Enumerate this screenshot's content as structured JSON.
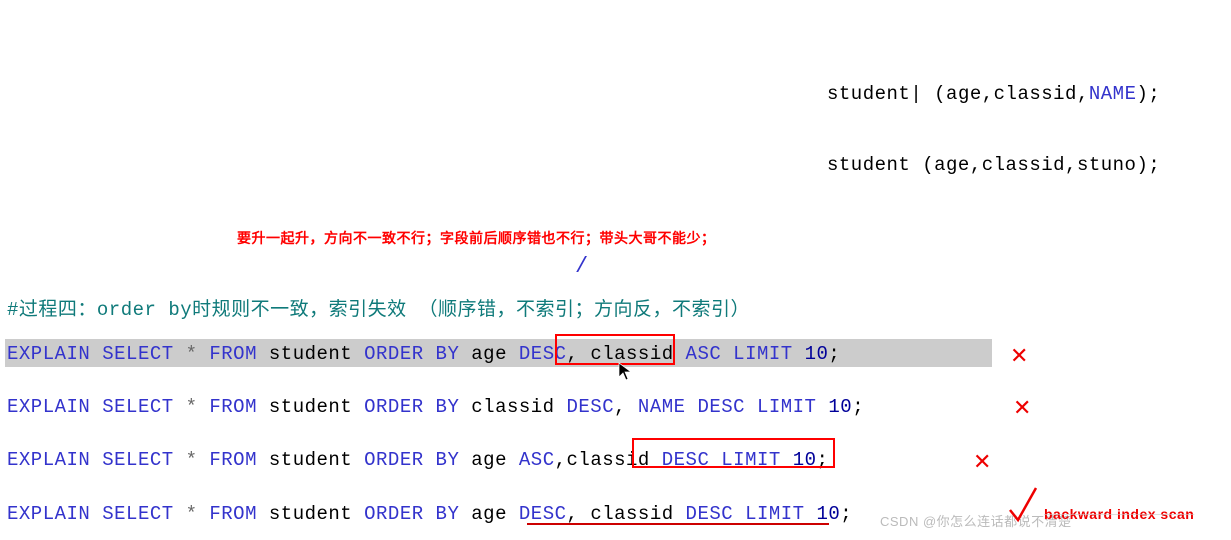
{
  "top1": {
    "student": "student",
    "cursor": "|",
    "open": " (age,classid,",
    "name_kw": "NAME",
    "close": ");"
  },
  "top2": {
    "text": "student (age,classid,stuno);"
  },
  "red_note": "要升一起升，方向不一致不行；字段前后顺序错也不行；带头大哥不能少；",
  "comment": "#过程四：order by时规则不一致，索引失效 （顺序错，不索引；方向反，不索引）",
  "dangling": "/",
  "sql1": {
    "explain": "EXPLAIN",
    "sp1": "  ",
    "select": "SELECT",
    "sp2": " ",
    "star": "*",
    "sp3": " ",
    "from": "FROM",
    "sp4": " ",
    "table": "student",
    "sp5": " ",
    "order": "ORDER",
    "sp6": " ",
    "by": "BY",
    "sp7": " ",
    "col1": "age",
    "sp8": " ",
    "dir1": "DESC",
    "com1": ",",
    "sp9": " ",
    "col2": "classid",
    "sp10": " ",
    "dir2": "ASC",
    "sp11": " ",
    "limit": "LIMIT",
    "sp12": " ",
    "num": "10",
    "semi": ";"
  },
  "sql2": {
    "explain": "EXPLAIN",
    "sp1": "  ",
    "select": "SELECT",
    "sp2": " ",
    "star": "*",
    "sp3": " ",
    "from": "FROM",
    "sp4": " ",
    "table": "student",
    "sp5": " ",
    "order": "ORDER",
    "sp6": " ",
    "by": "BY",
    "sp7": " ",
    "col1": "classid",
    "sp8": " ",
    "dir1": "DESC",
    "com1": ",",
    "sp9": " ",
    "col2": "NAME",
    "sp10": " ",
    "dir2": "DESC",
    "sp11": " ",
    "limit": "LIMIT",
    "sp12": " ",
    "num": "10",
    "semi": ";"
  },
  "sql3": {
    "explain": "EXPLAIN",
    "sp1": "  ",
    "select": "SELECT",
    "sp2": " ",
    "star": "*",
    "sp3": " ",
    "from": "FROM",
    "sp4": " ",
    "table": "student",
    "sp5": " ",
    "order": "ORDER",
    "sp6": " ",
    "by": "BY",
    "sp7": " ",
    "col1": "age",
    "sp8": " ",
    "dir1": "ASC",
    "com1": ",",
    "col2": "classid",
    "sp10": " ",
    "dir2": "DESC",
    "sp11": " ",
    "limit": "LIMIT",
    "sp12": " ",
    "num": "10",
    "semi": ";"
  },
  "sql4": {
    "explain": "EXPLAIN",
    "sp1": "  ",
    "select": "SELECT",
    "sp2": " ",
    "star": "*",
    "sp3": " ",
    "from": "FROM",
    "sp4": " ",
    "table": "student",
    "sp5": " ",
    "order": "ORDER",
    "sp6": " ",
    "by": "BY",
    "sp7": " ",
    "col1": "age",
    "sp8": " ",
    "dir1": "DESC",
    "com1": ",",
    "sp9": " ",
    "col2": "classid",
    "sp10": " ",
    "dir2": "DESC",
    "sp11": " ",
    "limit": "LIMIT",
    "sp12": " ",
    "num": "10",
    "semi": ";"
  },
  "x": "✕",
  "red_note_small": "backward index scan",
  "watermark": "CSDN @你怎么连话都说不清楚"
}
